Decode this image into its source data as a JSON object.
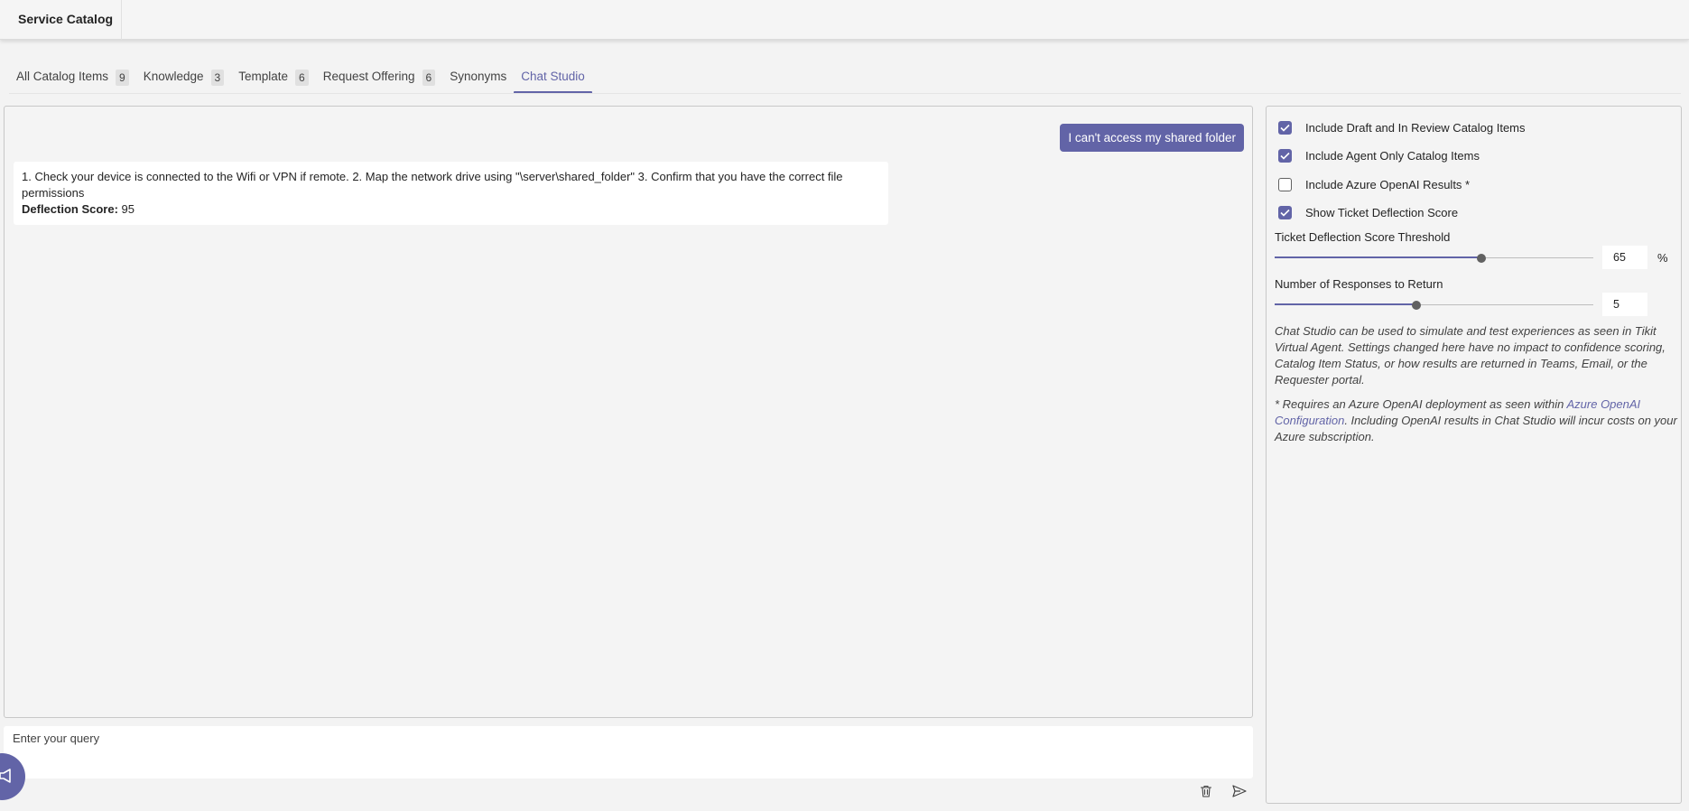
{
  "app": {
    "title": "Service Catalog"
  },
  "tabs": [
    {
      "label": "All Catalog Items",
      "count": "9"
    },
    {
      "label": "Knowledge",
      "count": "3"
    },
    {
      "label": "Template",
      "count": "6"
    },
    {
      "label": "Request Offering",
      "count": "6"
    },
    {
      "label": "Synonyms"
    },
    {
      "label": "Chat Studio",
      "active": true
    }
  ],
  "chat": {
    "user_message": "I can't access my shared folder",
    "bot_response": "1. Check your device is connected to the Wifi or VPN if remote. 2. Map the network drive using \"\\server\\shared_folder\" 3. Confirm that you have the correct file permissions",
    "deflection_label": "Deflection Score:",
    "deflection_value": "95",
    "input_placeholder": "Enter your query"
  },
  "settings": {
    "checkboxes": [
      {
        "label": "Include Draft and In Review Catalog Items",
        "checked": true
      },
      {
        "label": "Include Agent Only Catalog Items",
        "checked": true
      },
      {
        "label": "Include Azure OpenAI Results *",
        "checked": false
      },
      {
        "label": "Show Ticket Deflection Score",
        "checked": true
      }
    ],
    "threshold": {
      "label": "Ticket Deflection Score Threshold",
      "value": "65",
      "unit": "%",
      "fraction": 0.65
    },
    "responses": {
      "label": "Number of Responses to Return",
      "value": "5",
      "fraction": 0.444
    },
    "note1": "Chat Studio can be used to simulate and test experiences as seen in Tikit Virtual Agent. Settings changed here have no impact to confidence scoring, Catalog Item Status, or how results are returned in Teams, Email, or the Requester portal.",
    "note2_prefix": "* Requires an Azure OpenAI deployment as seen within ",
    "note2_link": "Azure OpenAI Configuration",
    "note2_suffix": ". Including OpenAI results in Chat Studio will incur costs on your Azure subscription."
  },
  "colors": {
    "accent": "#6264a7"
  },
  "icons": {
    "trash": "trash-icon",
    "send": "send-icon",
    "fab": "megaphone-icon",
    "check": "checkmark-icon"
  }
}
